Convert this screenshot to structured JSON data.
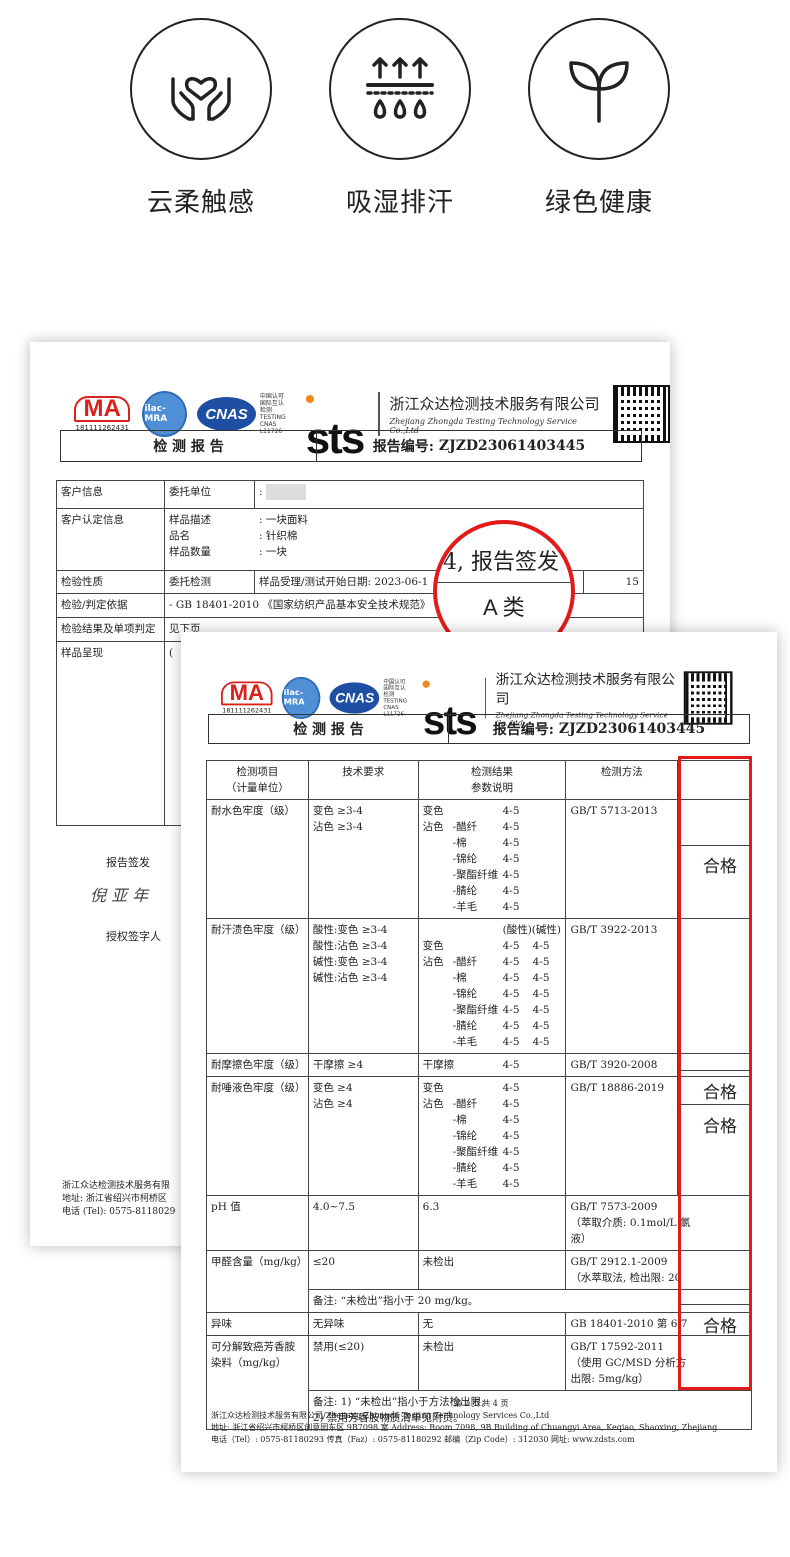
{
  "features": [
    {
      "icon": "heart-hands-icon",
      "label": "云柔触感"
    },
    {
      "icon": "moisture-wicking-icon",
      "label": "吸湿排汗"
    },
    {
      "icon": "sprout-icon",
      "label": "绿色健康"
    }
  ],
  "colors": {
    "red": "#e31a1a",
    "ma_red": "#d8201c",
    "cnas_blue": "#1e4fa3",
    "sts_orange": "#f08a1c"
  },
  "header": {
    "ma_number": "181111262431",
    "ilac_text": "ilac-MRA",
    "cnas_logo": "CNAS",
    "cnas_text": [
      "中国认可",
      "国际互认",
      "检测",
      "TESTING",
      "CNAS L11726"
    ],
    "sts": "sts",
    "company_cn": "浙江众达检测技术服务有限公司",
    "company_en": "Zhejiang Zhongda Testing Technology Service Co.,Ltd",
    "report_title": "检 测 报 告",
    "report_no_label": "报告编号:",
    "report_no": "ZJZD23061403445"
  },
  "back_page": {
    "rows": [
      {
        "label": "客户信息",
        "k1": "委托单位",
        "v1": ":"
      },
      {
        "label": "客户认定信息",
        "k1": "样品描述",
        "v1": ": 一块面料",
        "k2": "品名",
        "v2": ": 针织棉",
        "k3": "样品数量",
        "v3": ": 一块"
      },
      {
        "label": "检验性质",
        "k1": "委托检测",
        "v1": "样品受理/测试开始日期: 2023-06-1",
        "tail": "15"
      },
      {
        "label": "检验/判定依据",
        "k1": "-  GB 18401-2010 《国家纺织产品基本安全技术规范》",
        "v1": "A 类"
      },
      {
        "label": "检验结果及单项判定",
        "k1": "见下页"
      },
      {
        "label": "样品呈现",
        "k1": "("
      }
    ],
    "signer": "报告签发",
    "signature": "倪 亚 年",
    "auth": "授权签字人",
    "footer": [
      "浙江众达检测技术服务有限",
      "地址: 浙江省绍兴市柯桥区",
      "电话 (Tel): 0575-8118029"
    ]
  },
  "zoom": {
    "line1": "4, 报告签发",
    "line2": "A 类"
  },
  "front_table": {
    "head": [
      "检测项目",
      "（计量单位）",
      "技术要求",
      "检测结果",
      "参数说明",
      "检测方法"
    ],
    "rows": [
      {
        "item": "耐水色牢度（级）",
        "req": [
          "变色 ≥3-4",
          "沾色 ≥3-4"
        ],
        "res": [
          [
            "变色",
            "",
            "4-5"
          ],
          [
            "沾色",
            "-醋纤",
            "4-5"
          ],
          [
            "",
            "-棉",
            "4-5"
          ],
          [
            "",
            "-锦纶",
            "4-5"
          ],
          [
            "",
            "-聚酯纤维",
            "4-5"
          ],
          [
            "",
            "-腈纶",
            "4-5"
          ],
          [
            "",
            "-羊毛",
            "4-5"
          ]
        ],
        "method": "GB/T 5713-2013"
      },
      {
        "item": "耐汗渍色牢度（级）",
        "req": [
          "酸性:变色 ≥3-4",
          "酸性:沾色 ≥3-4",
          "碱性:变色 ≥3-4",
          "碱性:沾色 ≥3-4"
        ],
        "res_head": "(酸性)(碱性)",
        "res": [
          [
            "变色",
            "",
            "4-5",
            "4-5"
          ],
          [
            "沾色",
            "-醋纤",
            "4-5",
            "4-5"
          ],
          [
            "",
            "-棉",
            "4-5",
            "4-5"
          ],
          [
            "",
            "-锦纶",
            "4-5",
            "4-5"
          ],
          [
            "",
            "-聚酯纤维",
            "4-5",
            "4-5"
          ],
          [
            "",
            "-腈纶",
            "4-5",
            "4-5"
          ],
          [
            "",
            "-羊毛",
            "4-5",
            "4-5"
          ]
        ],
        "method": "GB/T 3922-2013"
      },
      {
        "item": "耐摩擦色牢度（级）",
        "req": [
          "干摩擦 ≥4"
        ],
        "res": [
          [
            "干摩擦",
            "",
            "4-5"
          ]
        ],
        "method": "GB/T 3920-2008"
      },
      {
        "item": "耐唾液色牢度（级）",
        "req": [
          "变色 ≥4",
          "沾色 ≥4"
        ],
        "res": [
          [
            "变色",
            "",
            "4-5"
          ],
          [
            "沾色",
            "-醋纤",
            "4-5"
          ],
          [
            "",
            "-棉",
            "4-5"
          ],
          [
            "",
            "-锦纶",
            "4-5"
          ],
          [
            "",
            "-聚酯纤维",
            "4-5"
          ],
          [
            "",
            "-腈纶",
            "4-5"
          ],
          [
            "",
            "-羊毛",
            "4-5"
          ]
        ],
        "method": "GB/T 18886-2019"
      },
      {
        "item": "pH 值",
        "req": [
          "4.0~7.5"
        ],
        "res": [
          [
            "6.3"
          ]
        ],
        "method": "GB/T 7573-2009",
        "method2": [
          "（萃取介质: 0.1mol/L 氯",
          "液）"
        ]
      },
      {
        "item": "甲醛含量（mg/kg）",
        "req": [
          "≤20"
        ],
        "res": [
          [
            "未检出"
          ]
        ],
        "method": "GB/T 2912.1-2009",
        "method2": [
          "（水萃取法, 检出限: 20"
        ]
      },
      {
        "item": "",
        "note": "备注: “未检出”指小于 20 mg/kg。"
      },
      {
        "item": "异味",
        "req": [
          "无异味"
        ],
        "res": [
          [
            "无"
          ]
        ],
        "method": "GB 18401-2010 第 6.7"
      },
      {
        "item": "可分解致癌芳香胺染料（mg/kg）",
        "req": [
          "禁用(≤20)"
        ],
        "res": [
          [
            "未检出"
          ]
        ],
        "method": "GB/T 17592-2011",
        "method2": [
          "（使用 GC/MSD 分析方",
          "出限: 5mg/kg）"
        ]
      },
      {
        "item": "",
        "note1": "备注: 1) “未检出”指小于方法检出限;",
        "note2": "2) 禁用芳香胺物质清单见附页。"
      }
    ],
    "pass": [
      "合格",
      "合格",
      "合格",
      "合格"
    ]
  },
  "front_footer": {
    "page": "第 2 页 共 4 页",
    "line1": "浙江众达检测技术服务有限公司/Zhejiang Zhongda Testing Technology Services Co.,Ltd",
    "line2": "地址: 浙江省绍兴市柯桥区创意园东区 9B7098 室    Address: Room 7098, 9B Building of Chuangyi Area, Keqiao, Shaoxing, Zhejiang",
    "line3": "电话（Tel）: 0575-81180293        传真（Faz）: 0575-81180292        邮编（Zip Code）: 312030        网址: www.zdsts.com"
  }
}
